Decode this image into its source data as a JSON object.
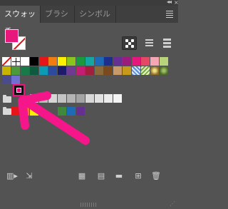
{
  "window": {
    "collapse_glyph": "◂◂",
    "close_glyph": "×"
  },
  "tabs": [
    {
      "label": "スウォッチ",
      "active": true
    },
    {
      "label": "ブラシ",
      "active": false
    },
    {
      "label": "シンボル",
      "active": false
    }
  ],
  "toolbar": {
    "fill_color": "#e8177c",
    "stroke_state": "none",
    "view_modes": [
      "show-swatch-kinds-icon",
      "small-list-view-icon",
      "large-list-view-icon"
    ]
  },
  "swatch_rows": [
    [
      "none",
      "registration",
      "#ffffff",
      "#000000",
      "#e5161a",
      "#ef7d12",
      "#fff000",
      "#8ac41c",
      "#1a9a3d",
      "#14a6a0",
      "#1d6bb6",
      "#1c2f8e",
      "#663092",
      "#9a1c7d",
      "#e5177c",
      "#e54864"
    ],
    [
      "#c8b400",
      "#4c9a3c",
      "#177a48",
      "#0e5a3e",
      "#0d9ab5",
      "#2c4b9d",
      "#1c1c6b",
      "#6e3a92",
      "#c61d74",
      "#a31d3c",
      "#8a6a3a",
      "#7a4a1e",
      "#c89a6a",
      "#c79a1c",
      "pattern-blue",
      "pattern-green"
    ],
    [
      "#4a4a8c",
      "#7070d0",
      "#e8177c-selected",
      "#d0d0d0",
      "#bdbdbd",
      "#a8a8a8",
      "#959595",
      "#828282",
      "#6f6f6f",
      "#5c5c5c",
      "#494949"
    ],
    [
      "#e5161a",
      "#ef7d12",
      "#fff000",
      "#3e8a3a",
      "#1d6bb6",
      "#663092"
    ]
  ],
  "selected_swatch": {
    "color": "#e8177c"
  },
  "annotation": {
    "color": "#f5168a"
  },
  "bottom_icons": [
    "swatch-libraries-icon",
    "place-swatches-icon",
    "color-group-icon",
    "swatch-options-icon",
    "new-color-group-icon",
    "new-swatch-icon",
    "delete-swatch-icon"
  ]
}
